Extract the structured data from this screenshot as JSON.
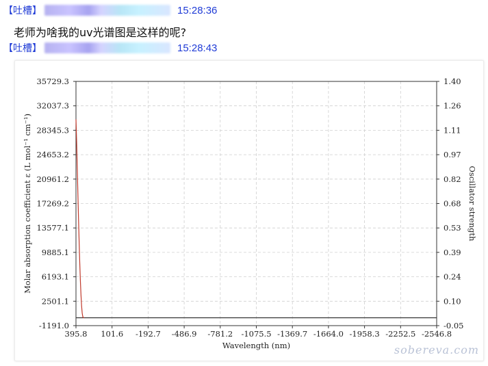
{
  "messages": [
    {
      "tag": "【吐槽】",
      "time": "15:28:36",
      "text": "老师为啥我的uv光谱图是这样的呢?"
    },
    {
      "tag": "【吐槽】",
      "time": "15:28:43"
    }
  ],
  "watermark": "sobereva.com",
  "chart_data": {
    "type": "line",
    "xlabel": "Wavelength (nm)",
    "ylabel": "Molar absorption coefficient ε (L mol⁻¹ cm⁻¹)",
    "ylabel_right": "Oscillator strength",
    "xlim": [
      395.8,
      -2546.8
    ],
    "ylim": [
      -1191.0,
      35729.3
    ],
    "ylim_right": [
      -0.05,
      1.4
    ],
    "x_ticks": [
      "395.8",
      "101.6",
      "-192.7",
      "-486.9",
      "-781.2",
      "-1075.5",
      "-1369.7",
      "-1664.0",
      "-1958.3",
      "-2252.5",
      "-2546.8"
    ],
    "y_ticks": [
      "35729.3",
      "32037.3",
      "28345.3",
      "24653.2",
      "20961.2",
      "17269.2",
      "13577.1",
      "9885.1",
      "6193.1",
      "2501.1",
      "-1191.0"
    ],
    "y_right_ticks": [
      "1.40",
      "1.26",
      "1.11",
      "0.97",
      "0.82",
      "0.68",
      "0.53",
      "0.39",
      "0.24",
      "0.10",
      "-0.05"
    ],
    "grid": true,
    "series": [
      {
        "color": "#c0392b",
        "x": [
          395.8,
          390,
          385,
          380,
          375,
          370,
          365,
          360,
          355,
          350,
          345,
          340,
          335,
          330
        ],
        "y": [
          30000,
          26500,
          22500,
          18800,
          15000,
          11600,
          8400,
          5700,
          3500,
          1800,
          700,
          150,
          20,
          0
        ]
      }
    ],
    "baseline": {
      "color": "#333333",
      "y": 0
    }
  }
}
